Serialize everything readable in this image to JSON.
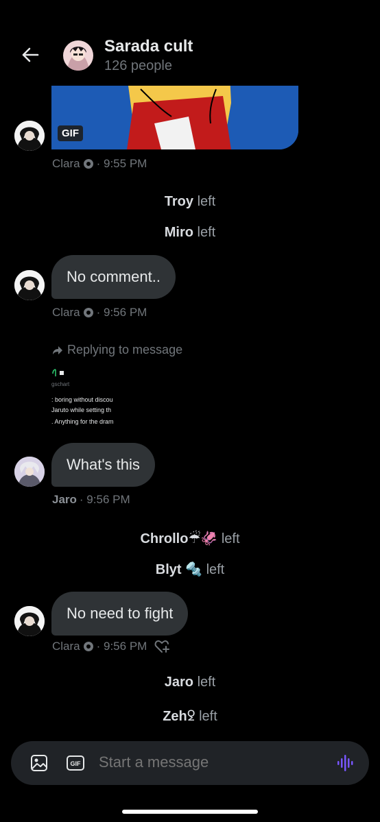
{
  "header": {
    "title": "Sarada cult",
    "subtitle": "126 people",
    "back_icon": "arrow-left-icon",
    "avatar_icon": "group-avatar"
  },
  "messages": {
    "gif_badge": "GIF",
    "msg1_meta": {
      "name": "Clara",
      "time": "· 9:55 PM"
    },
    "system1": {
      "name": "Troy",
      "action": "left"
    },
    "system2": {
      "name": "Miro",
      "action": "left"
    },
    "msg2": {
      "text": "No comment..",
      "name": "Clara",
      "time": "· 9:56 PM"
    },
    "reply": {
      "label": "Replying to message",
      "preview_handle": "gschart",
      "preview_line1": ": boring without discou",
      "preview_line2": "Jaruto while setting th",
      "preview_line3": ". Anything for the dram"
    },
    "msg3": {
      "text": "What's this",
      "name": "Jaro",
      "time": "· 9:56 PM"
    },
    "system3": {
      "name": "Chrollo☔🦑",
      "action": "left"
    },
    "system4": {
      "name": "Blyt 🔩",
      "action": "left"
    },
    "msg4": {
      "text": "No need to fight",
      "name": "Clara",
      "time": "· 9:56 PM"
    },
    "system5": {
      "name": "Jaro",
      "action": "left"
    },
    "system6": {
      "name": "Zeh",
      "action": "left"
    }
  },
  "composer": {
    "placeholder": "Start a message",
    "image_icon": "image-icon",
    "gif_icon": "gif-icon",
    "voice_icon": "voice-icon"
  },
  "colors": {
    "background": "#000000",
    "bubble": "#2f3336",
    "muted": "#71767b",
    "accent": "#7856ff"
  }
}
